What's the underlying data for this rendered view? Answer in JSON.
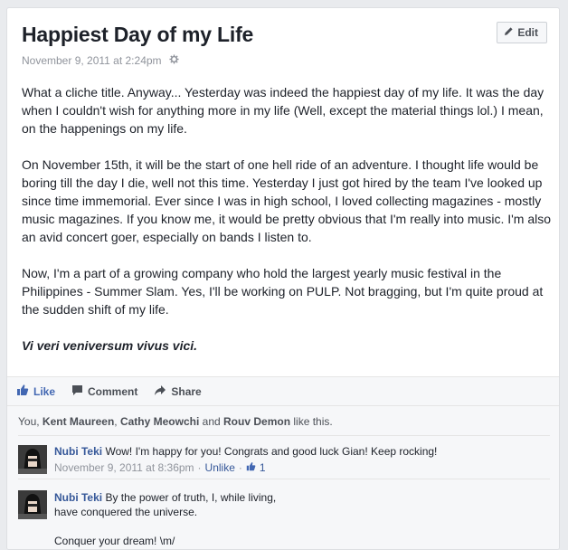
{
  "post": {
    "title": "Happiest Day of my Life",
    "edit_label": "Edit",
    "date": "November 9, 2011 at 2:24pm",
    "paragraphs": [
      "What a cliche title. Anyway... Yesterday was indeed the happiest day of my life. It was the day when I couldn't wish for anything more in my life (Well, except the material things lol.) I mean, on the happenings on my life.",
      "On November 15th, it will be the start of one hell ride of an adventure. I thought life would be boring till the day I die, well not this time. Yesterday I just got hired by the team I've looked up since time immemorial. Ever since I was in high school, I loved collecting magazines - mostly music magazines. If you know me, it would be pretty obvious that I'm really into music. I'm also an avid concert goer, especially on bands I listen to.",
      "Now, I'm a part of a growing company who hold the largest yearly music festival in the Philippines - Summer Slam. Yes, I'll be working on PULP. Not bragging, but I'm quite proud at the sudden shift of my life."
    ],
    "closing": "Vi veri veniversum vivus vici."
  },
  "actions": {
    "like": "Like",
    "comment": "Comment",
    "share": "Share"
  },
  "likes": {
    "prefix": "You, ",
    "name1": "Kent Maureen",
    "sep1": ", ",
    "name2": "Cathy Meowchi",
    "sep2": " and ",
    "name3": "Rouv Demon",
    "suffix": " like this."
  },
  "comments": [
    {
      "author": "Nubi Teki",
      "text": " Wow! I'm happy for you! Congrats and good luck Gian! Keep rocking!",
      "date": "November 9, 2011 at 8:36pm",
      "unlike": "Unlike",
      "like_count": "1"
    },
    {
      "author": "Nubi Teki",
      "line1": " By the power of truth, I, while living,",
      "line2": "have conquered the universe.",
      "line3": "Conquer your dream! \\m/"
    }
  ],
  "colors": {
    "accent": "#4267b2",
    "link": "#365899",
    "muted": "#90949c"
  }
}
